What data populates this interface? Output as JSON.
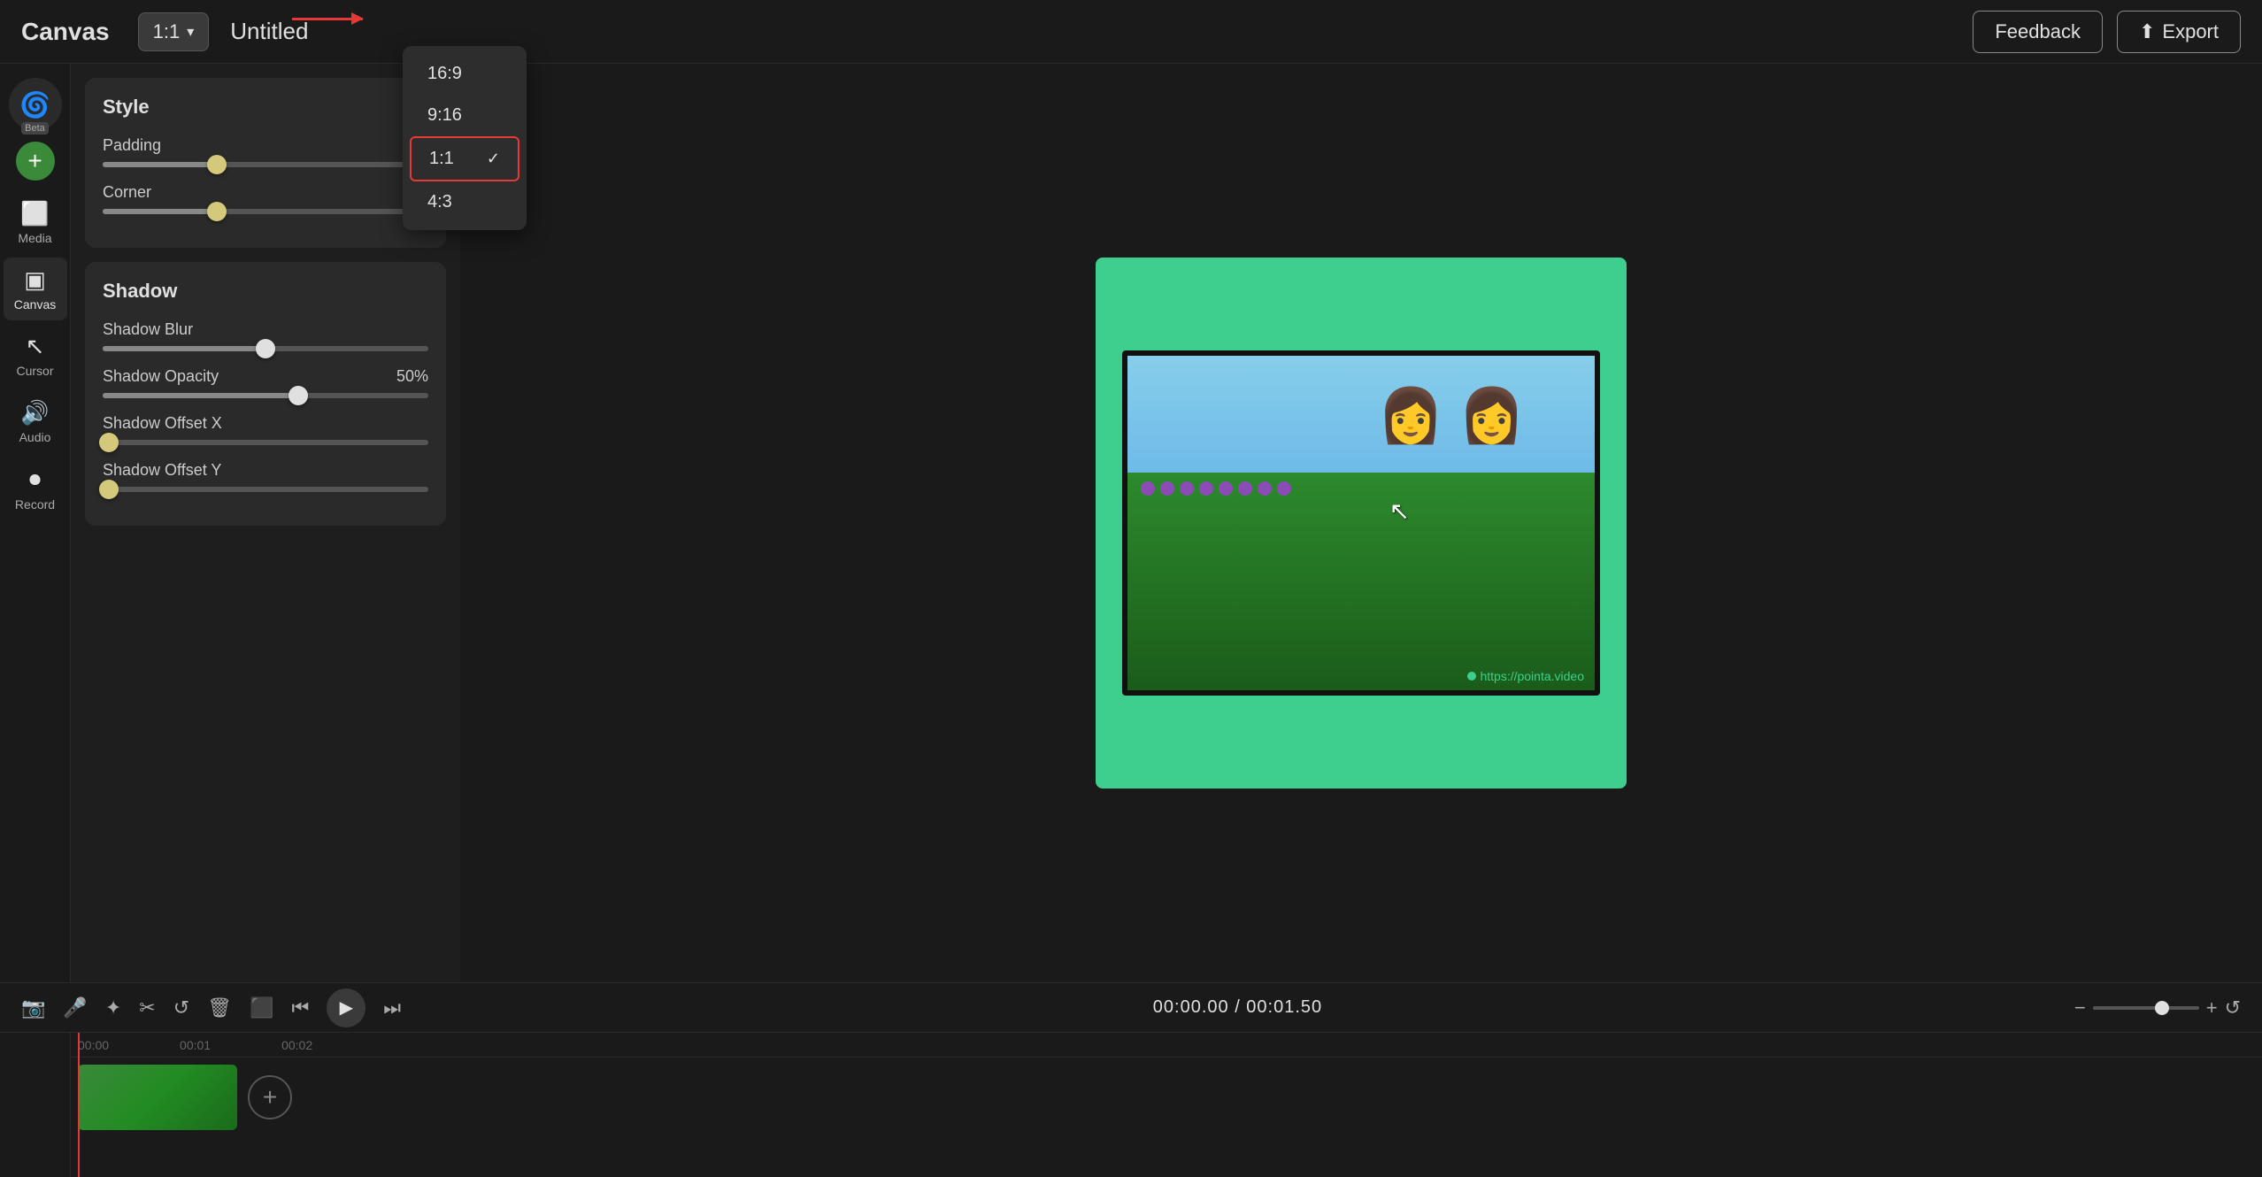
{
  "topbar": {
    "title": "Canvas",
    "untitled": "Untitled",
    "aspect_current": "1:1",
    "feedback_label": "Feedback",
    "export_label": "Export"
  },
  "aspect_options": [
    {
      "label": "16:9",
      "selected": false
    },
    {
      "label": "9:16",
      "selected": false
    },
    {
      "label": "1:1",
      "selected": true
    },
    {
      "label": "4:3",
      "selected": false
    }
  ],
  "sidebar": {
    "items": [
      {
        "label": "Media",
        "icon": "🎬"
      },
      {
        "label": "Canvas",
        "icon": "⬜",
        "active": true
      },
      {
        "label": "Cursor",
        "icon": "🖱"
      },
      {
        "label": "Audio",
        "icon": "🔊"
      },
      {
        "label": "Record",
        "icon": "⏺"
      }
    ]
  },
  "style_section": {
    "title": "Style",
    "padding_label": "Padding",
    "padding_value": 35,
    "corner_label": "Corner",
    "corner_value": 35
  },
  "shadow_section": {
    "title": "Shadow",
    "blur_label": "Shadow Blur",
    "blur_value": 50,
    "opacity_label": "Shadow Opacity",
    "opacity_value": 50,
    "opacity_display": "50%",
    "offset_x_label": "Shadow Offset X",
    "offset_x_value": 0,
    "offset_y_label": "Shadow Offset Y",
    "offset_y_value": 0
  },
  "timeline": {
    "current_time": "00:00.00",
    "total_time": "00:01.50",
    "time_display": "00:00.00 / 00:01.50",
    "ruler_marks": [
      "00:00",
      "00:01",
      "00:02"
    ]
  },
  "watermark": {
    "text": "https://pointa.video"
  },
  "canvas_bg": "#3ecf8e"
}
